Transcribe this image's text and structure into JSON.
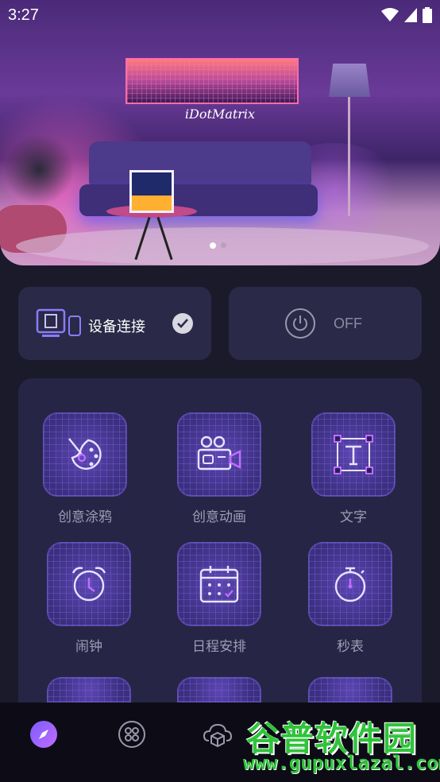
{
  "status_bar": {
    "time": "3:27"
  },
  "banner": {
    "brand_text": "iDotMatrix",
    "page_indicator": {
      "current": 1,
      "total": 2
    }
  },
  "device": {
    "label": "设备连接",
    "connected": true
  },
  "power": {
    "label": "OFF"
  },
  "features": [
    {
      "label": "创意涂鸦",
      "icon": "palette-icon"
    },
    {
      "label": "创意动画",
      "icon": "video-camera-icon"
    },
    {
      "label": "文字",
      "icon": "text-icon"
    },
    {
      "label": "闹钟",
      "icon": "alarm-clock-icon"
    },
    {
      "label": "日程安排",
      "icon": "calendar-icon"
    },
    {
      "label": "秒表",
      "icon": "stopwatch-icon"
    }
  ],
  "nav": [
    {
      "name": "discover",
      "icon": "compass-icon",
      "active": true
    },
    {
      "name": "apps",
      "icon": "grid-icon",
      "active": false
    },
    {
      "name": "cloud",
      "icon": "cloud-box-icon",
      "active": false
    }
  ],
  "watermark": {
    "title": "谷普软件园",
    "url": "www.gupuxlazal.com"
  },
  "colors": {
    "background": "#1b1a2b",
    "card": "#2a2947",
    "accent": "#7c5cff",
    "muted_text": "#9e9cb4"
  }
}
